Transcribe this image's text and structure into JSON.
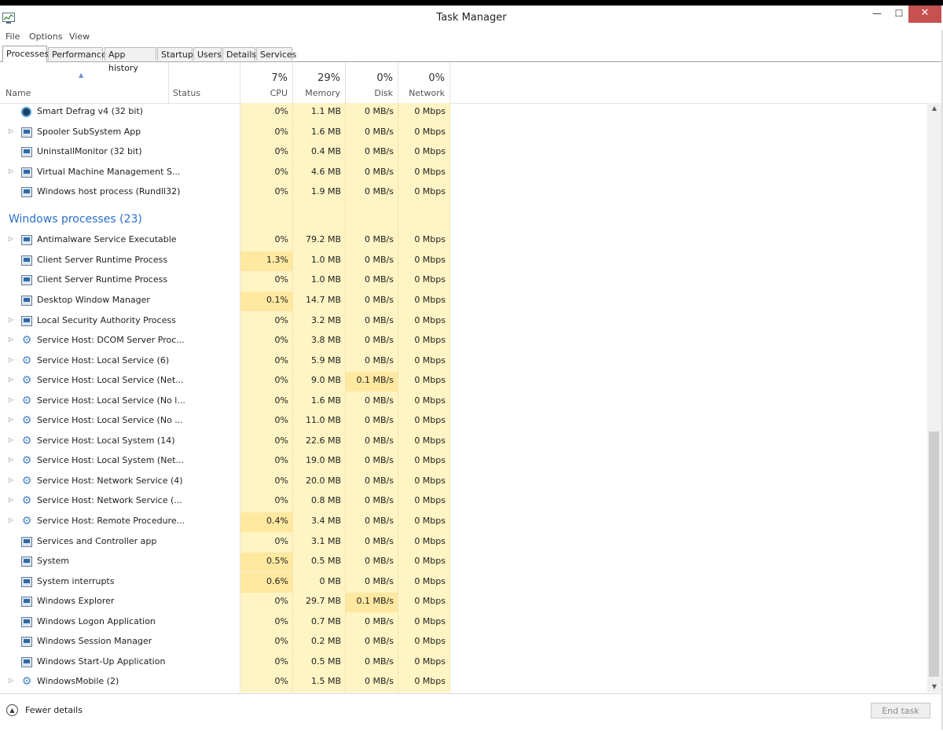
{
  "window": {
    "title": "Task Manager",
    "min_glyph": "—",
    "max_glyph": "☐",
    "close_glyph": "✕"
  },
  "menu": [
    "File",
    "Options",
    "View"
  ],
  "tabs": [
    "Processes",
    "Performance",
    "App history",
    "Startup",
    "Users",
    "Details",
    "Services"
  ],
  "active_tab": "Processes",
  "columns": {
    "name": "Name",
    "status": "Status",
    "cpu": {
      "pct": "7%",
      "label": "CPU"
    },
    "memory": {
      "pct": "29%",
      "label": "Memory"
    },
    "disk": {
      "pct": "0%",
      "label": "Disk"
    },
    "network": {
      "pct": "0%",
      "label": "Network"
    }
  },
  "colors": {
    "heat_low": "#fff4c4",
    "heat_high": "#ffe8a0",
    "group_title": "#2a6fc9"
  },
  "processes_top": [
    {
      "name": "Smart Defrag v4 (32 bit)",
      "icon": "defrag-icon",
      "expand": false,
      "cpu": "0%",
      "mem": "1.1 MB",
      "disk": "0 MB/s",
      "net": "0 Mbps"
    },
    {
      "name": "Spooler SubSystem App",
      "icon": "window-icon",
      "expand": true,
      "cpu": "0%",
      "mem": "1.6 MB",
      "disk": "0 MB/s",
      "net": "0 Mbps"
    },
    {
      "name": "UninstallMonitor (32 bit)",
      "icon": "window-icon",
      "expand": false,
      "cpu": "0%",
      "mem": "0.4 MB",
      "disk": "0 MB/s",
      "net": "0 Mbps"
    },
    {
      "name": "Virtual Machine Management S...",
      "icon": "window-icon",
      "expand": true,
      "cpu": "0%",
      "mem": "4.6 MB",
      "disk": "0 MB/s",
      "net": "0 Mbps"
    },
    {
      "name": "Windows host process (Rundll32)",
      "icon": "window-icon",
      "expand": false,
      "cpu": "0%",
      "mem": "1.9 MB",
      "disk": "0 MB/s",
      "net": "0 Mbps"
    }
  ],
  "group": {
    "title": "Windows processes (23)"
  },
  "processes_windows": [
    {
      "name": "Antimalware Service Executable",
      "icon": "window-icon",
      "expand": true,
      "cpu": "0%",
      "mem": "79.2 MB",
      "disk": "0 MB/s",
      "net": "0 Mbps"
    },
    {
      "name": "Client Server Runtime Process",
      "icon": "window-icon",
      "expand": false,
      "cpu": "1.3%",
      "mem": "1.0 MB",
      "disk": "0 MB/s",
      "net": "0 Mbps"
    },
    {
      "name": "Client Server Runtime Process",
      "icon": "window-icon",
      "expand": false,
      "cpu": "0%",
      "mem": "1.0 MB",
      "disk": "0 MB/s",
      "net": "0 Mbps"
    },
    {
      "name": "Desktop Window Manager",
      "icon": "window-icon",
      "expand": false,
      "cpu": "0.1%",
      "mem": "14.7 MB",
      "disk": "0 MB/s",
      "net": "0 Mbps"
    },
    {
      "name": "Local Security Authority Process",
      "icon": "window-icon",
      "expand": true,
      "cpu": "0%",
      "mem": "3.2 MB",
      "disk": "0 MB/s",
      "net": "0 Mbps"
    },
    {
      "name": "Service Host: DCOM Server Proc...",
      "icon": "gear-icon",
      "expand": true,
      "cpu": "0%",
      "mem": "3.8 MB",
      "disk": "0 MB/s",
      "net": "0 Mbps"
    },
    {
      "name": "Service Host: Local Service (6)",
      "icon": "gear-icon",
      "expand": true,
      "cpu": "0%",
      "mem": "5.9 MB",
      "disk": "0 MB/s",
      "net": "0 Mbps"
    },
    {
      "name": "Service Host: Local Service (Net...",
      "icon": "gear-icon",
      "expand": true,
      "cpu": "0%",
      "mem": "9.0 MB",
      "disk": "0.1 MB/s",
      "net": "0 Mbps"
    },
    {
      "name": "Service Host: Local Service (No l...",
      "icon": "gear-icon",
      "expand": true,
      "cpu": "0%",
      "mem": "1.6 MB",
      "disk": "0 MB/s",
      "net": "0 Mbps"
    },
    {
      "name": "Service Host: Local Service (No ...",
      "icon": "gear-icon",
      "expand": true,
      "cpu": "0%",
      "mem": "11.0 MB",
      "disk": "0 MB/s",
      "net": "0 Mbps"
    },
    {
      "name": "Service Host: Local System (14)",
      "icon": "gear-icon",
      "expand": true,
      "cpu": "0%",
      "mem": "22.6 MB",
      "disk": "0 MB/s",
      "net": "0 Mbps"
    },
    {
      "name": "Service Host: Local System (Net...",
      "icon": "gear-icon",
      "expand": true,
      "cpu": "0%",
      "mem": "19.0 MB",
      "disk": "0 MB/s",
      "net": "0 Mbps"
    },
    {
      "name": "Service Host: Network Service (4)",
      "icon": "gear-icon",
      "expand": true,
      "cpu": "0%",
      "mem": "20.0 MB",
      "disk": "0 MB/s",
      "net": "0 Mbps"
    },
    {
      "name": "Service Host: Network Service (...",
      "icon": "gear-icon",
      "expand": true,
      "cpu": "0%",
      "mem": "0.8 MB",
      "disk": "0 MB/s",
      "net": "0 Mbps"
    },
    {
      "name": "Service Host: Remote Procedure...",
      "icon": "gear-icon",
      "expand": true,
      "cpu": "0.4%",
      "mem": "3.4 MB",
      "disk": "0 MB/s",
      "net": "0 Mbps"
    },
    {
      "name": "Services and Controller app",
      "icon": "window-icon",
      "expand": false,
      "cpu": "0%",
      "mem": "3.1 MB",
      "disk": "0 MB/s",
      "net": "0 Mbps"
    },
    {
      "name": "System",
      "icon": "window-icon",
      "expand": false,
      "cpu": "0.5%",
      "mem": "0.5 MB",
      "disk": "0 MB/s",
      "net": "0 Mbps"
    },
    {
      "name": "System interrupts",
      "icon": "window-icon",
      "expand": false,
      "cpu": "0.6%",
      "mem": "0 MB",
      "disk": "0 MB/s",
      "net": "0 Mbps"
    },
    {
      "name": "Windows Explorer",
      "icon": "window-icon",
      "expand": false,
      "cpu": "0%",
      "mem": "29.7 MB",
      "disk": "0.1 MB/s",
      "net": "0 Mbps"
    },
    {
      "name": "Windows Logon Application",
      "icon": "window-icon",
      "expand": false,
      "cpu": "0%",
      "mem": "0.7 MB",
      "disk": "0 MB/s",
      "net": "0 Mbps"
    },
    {
      "name": "Windows Session Manager",
      "icon": "window-icon",
      "expand": false,
      "cpu": "0%",
      "mem": "0.2 MB",
      "disk": "0 MB/s",
      "net": "0 Mbps"
    },
    {
      "name": "Windows Start-Up Application",
      "icon": "window-icon",
      "expand": false,
      "cpu": "0%",
      "mem": "0.5 MB",
      "disk": "0 MB/s",
      "net": "0 Mbps"
    },
    {
      "name": "WindowsMobile (2)",
      "icon": "gear-icon",
      "expand": true,
      "cpu": "0%",
      "mem": "1.5 MB",
      "disk": "0 MB/s",
      "net": "0 Mbps"
    }
  ],
  "footer": {
    "fewer_details": "Fewer details",
    "end_task": "End task"
  }
}
